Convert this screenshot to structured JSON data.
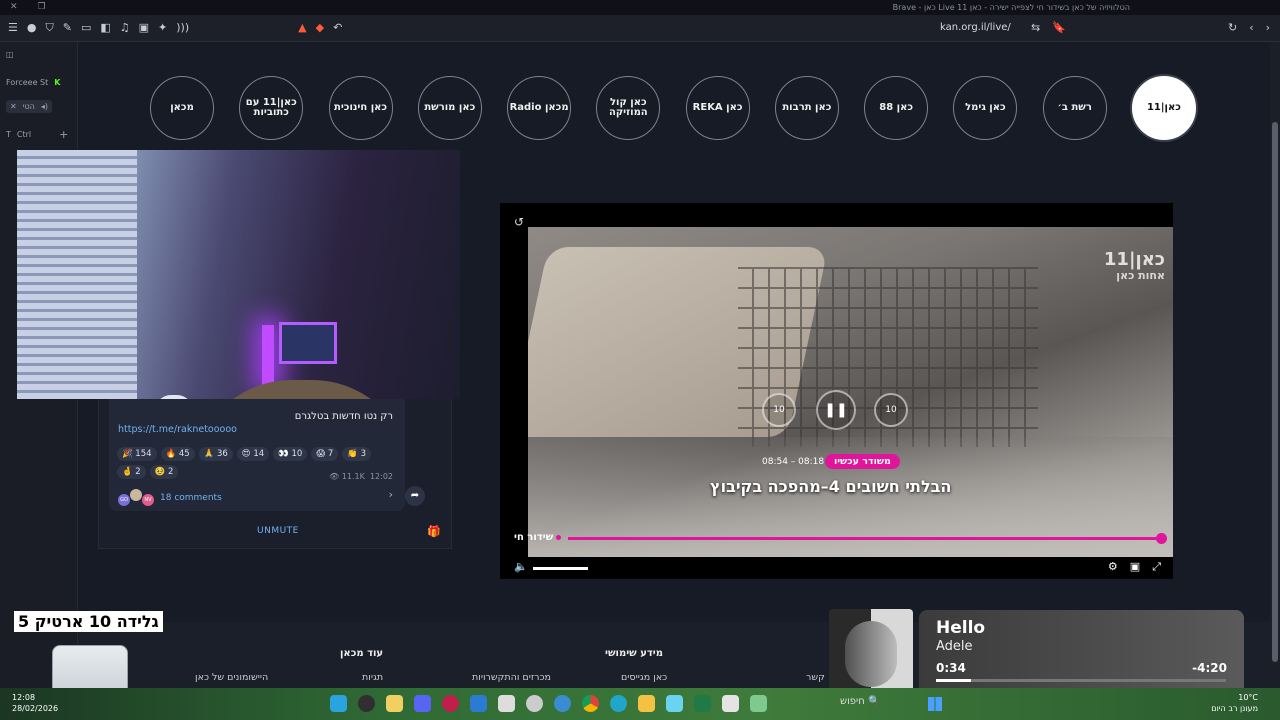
{
  "window": {
    "title": "הטלוויזיה של כאן בשידור חי לצפייה ישירה - כאן 11 Live כאן - Brave"
  },
  "browser": {
    "url": "kan.org.il/live/"
  },
  "sidebar": {
    "tab1_label": "Forceee St",
    "tab2_label": "הטי",
    "tab3_label": "Ctrl"
  },
  "channels": [
    {
      "label": "כאן|11",
      "active": true
    },
    {
      "label": "רשת ב׳"
    },
    {
      "label": "כאן גימל"
    },
    {
      "label": "כאן 88"
    },
    {
      "label": "כאן תרבות"
    },
    {
      "label": "כאן REKA"
    },
    {
      "label": "כאן קול המוזיקה"
    },
    {
      "label": "מכאן Radio"
    },
    {
      "label": "כאן מורשת"
    },
    {
      "label": "כאן חינוכית"
    },
    {
      "label": "כאן|11 עם כתוביות"
    },
    {
      "label": "מכאן"
    }
  ],
  "telegram": {
    "text": "רק נטו חדשות בטלגרם",
    "link": "https://t.me/raknetooooo",
    "reactions": [
      {
        "emoji": "🎉",
        "count": "154"
      },
      {
        "emoji": "🔥",
        "count": "45"
      },
      {
        "emoji": "🙏",
        "count": "36"
      },
      {
        "emoji": "😍",
        "count": "14"
      },
      {
        "emoji": "👀",
        "count": "10"
      },
      {
        "emoji": "😱",
        "count": "7"
      },
      {
        "emoji": "👏",
        "count": "3"
      },
      {
        "emoji": "🤞",
        "count": "2"
      },
      {
        "emoji": "🥹",
        "count": "2"
      }
    ],
    "views": "11.1K",
    "time": "12:02",
    "comments": "18 comments",
    "unmute": "UNMUTE"
  },
  "player": {
    "watermark": "כאן|11",
    "watermark_sub": "אחות כאן",
    "skip_back": "10",
    "skip_fwd": "10",
    "live_pill": "משודר עכשיו",
    "times": "08:54 – 08:18",
    "program_title": "הבלתי חשובים 4–מהפכה בקיבוץ",
    "live_label": "שידור חי"
  },
  "overlay": {
    "text": "גלידה 10 ארטיק 5"
  },
  "footer": {
    "col1_heading": "עוד מכאן",
    "col2_heading": "מידע שימושי",
    "link1": "היישומונים של כאן",
    "link2": "תגיות",
    "link3": "מכרזים והתקשרויות",
    "link4": "כאן מגייסים",
    "link5": "קשר"
  },
  "spotify": {
    "song": "Hello",
    "artist": "Adele",
    "elapsed": "0:34",
    "remaining": "-4:20",
    "progress": 0.12
  },
  "taskbar": {
    "time": "12:08",
    "date": "28/02/2026",
    "search": "חיפוש",
    "temp": "10°C",
    "weather": "מעונן רב היום"
  }
}
